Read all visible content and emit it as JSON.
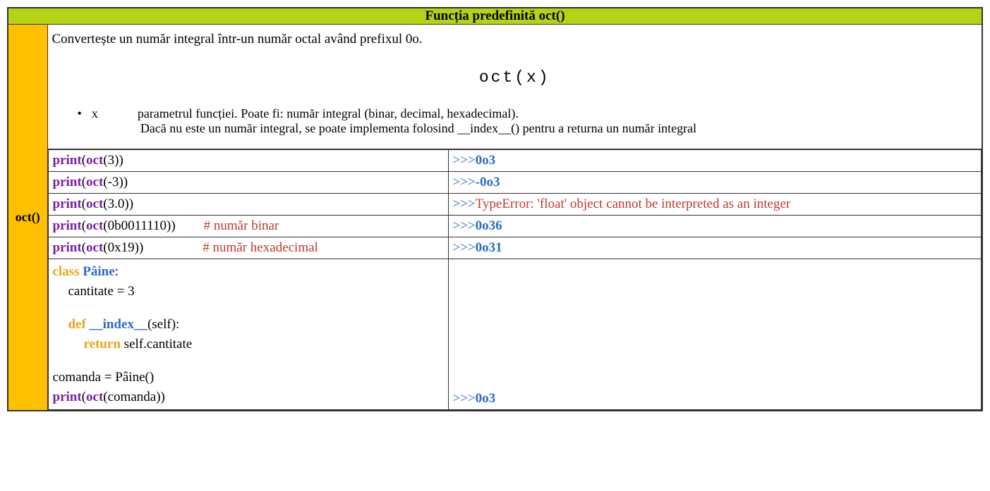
{
  "header": "Funcția predefinită oct()",
  "side_label": "oct()",
  "description": "Convertește un număr integral într-un număr octal având prefixul 0o.",
  "signature": "oct(x)",
  "param": {
    "bullet": "•",
    "name": "x",
    "desc1": "parametrul funcției. Poate fi: număr integral (binar, decimal, hexadecimal).",
    "desc2": "Dacă nu este un număr integral, se poate implementa folosind __index__() pentru a returna un număr integral"
  },
  "rows": [
    {
      "code": {
        "print": "print",
        "lp": "(",
        "func": "oct",
        "lp2": "(",
        "arg": "3",
        "rp2": ")",
        "rp": ")"
      },
      "out": {
        "prompt": ">>>",
        "result": "0o3"
      }
    },
    {
      "code": {
        "print": "print",
        "lp": "(",
        "func": "oct",
        "lp2": "(",
        "arg": "-3",
        "rp2": ")",
        "rp": ")"
      },
      "out": {
        "prompt": ">>>",
        "result": "-0o3"
      }
    },
    {
      "code": {
        "print": "print",
        "lp": "(",
        "func": "oct",
        "lp2": "(",
        "arg": "3.0",
        "rp2": ")",
        "rp": ")"
      },
      "out": {
        "prompt": ">>>",
        "error": "TypeError: 'float' object cannot be interpreted as an integer"
      }
    },
    {
      "code": {
        "print": "print",
        "lp": "(",
        "func": "oct",
        "lp2": "(",
        "arg": "0b0011110",
        "rp2": ")",
        "rp": ")",
        "comment": "# număr binar"
      },
      "out": {
        "prompt": ">>>",
        "result": "0o36"
      }
    },
    {
      "code": {
        "print": "print",
        "lp": "(",
        "func": "oct",
        "lp2": "(",
        "arg": "0x19",
        "rp2": ")",
        "rp": ")",
        "comment": "# număr hexadecimal"
      },
      "out": {
        "prompt": ">>>",
        "result": "0o31"
      }
    }
  ],
  "class_example": {
    "class_kw": "class",
    "class_name": "Pâine",
    "colon": ":",
    "attr_line": "cantitate = 3",
    "def_kw": "def",
    "method_name": "__index__",
    "method_sig": "(self):",
    "return_kw": "return",
    "return_expr": " self.cantitate",
    "assign": "comanda = Pâine()",
    "print": "print",
    "lp": "(",
    "func": "oct",
    "lp2": "(",
    "arg": "comanda",
    "rp2": ")",
    "rp": ")",
    "out_prompt": ">>>",
    "out_result": "0o3"
  }
}
